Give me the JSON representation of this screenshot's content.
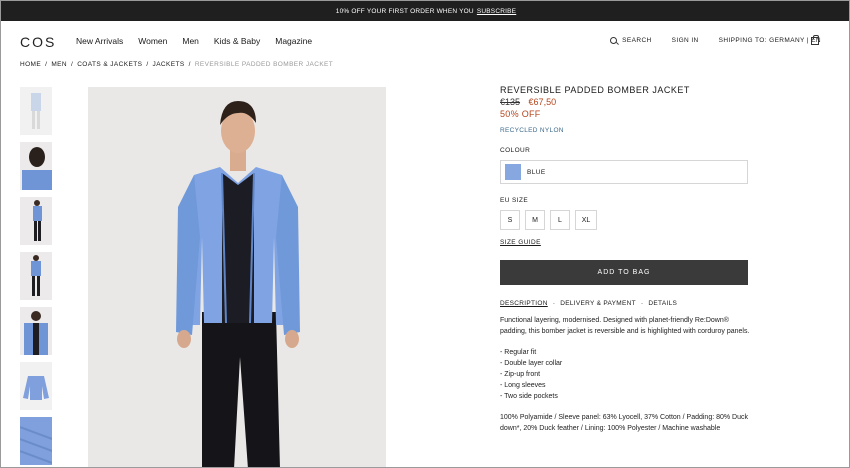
{
  "promo": {
    "text": "10% OFF YOUR FIRST ORDER WHEN YOU",
    "link": "SUBSCRIBE"
  },
  "header": {
    "logo": "COS",
    "nav": [
      "New Arrivals",
      "Women",
      "Men",
      "Kids & Baby",
      "Magazine"
    ],
    "search": "SEARCH",
    "signin": "SIGN IN",
    "shipping": "SHIPPING TO: GERMANY | EN"
  },
  "breadcrumb": [
    "HOME",
    "/",
    "MEN",
    "/",
    "COATS & JACKETS",
    "/",
    "JACKETS",
    "/",
    "REVERSIBLE PADDED BOMBER JACKET"
  ],
  "product": {
    "title": "REVERSIBLE PADDED BOMBER JACKET",
    "old_price": "€135",
    "new_price": "€67,50",
    "discount": "50% OFF",
    "material": "RECYCLED NYLON",
    "colour_label": "COLOUR",
    "colour_value": "BLUE",
    "swatch_color": "#87a7e0",
    "size_label": "EU SIZE",
    "sizes": [
      "S",
      "M",
      "L",
      "XL"
    ],
    "size_guide": "SIZE GUIDE",
    "add_to_bag": "ADD TO BAG"
  },
  "tabs": [
    "DESCRIPTION",
    "DELIVERY & PAYMENT",
    "DETAILS"
  ],
  "description": {
    "intro": "Functional layering, modernised. Designed with planet-friendly Re:Down® padding, this bomber jacket is reversible and is highlighted with corduroy panels.",
    "bullets": [
      "- Regular fit",
      "- Double layer collar",
      "- Zip-up front",
      "- Long sleeves",
      "- Two side pockets"
    ],
    "composition": "100% Polyamide / Sleeve panel: 63% Lyocell, 37% Cotton / Padding: 80% Duck down*, 20% Duck feather / Lining: 100% Polyester / Machine washable"
  }
}
